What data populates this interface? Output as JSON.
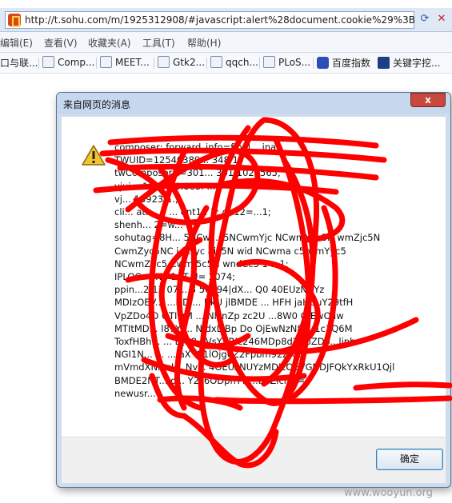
{
  "browser": {
    "url": "http://t.sohu.com/m/1925312908/#javascript:alert%28document.cookie%29%3B",
    "menu": [
      "编辑(E)",
      "查看(V)",
      "收藏夹(A)",
      "工具(T)",
      "帮助(H)"
    ],
    "favorites": [
      "口与联...",
      "Comp...",
      "MEET...",
      "Gtk2...",
      "qqch...",
      "PLoS...",
      "百度指数",
      "关键字挖..."
    ]
  },
  "dialog": {
    "title": "来自网页的消息",
    "close_label": "x",
    "ok_label": "确定",
    "message_lines": [
      "composer; forward_info=final...                  inal;",
      "TWUID=12540389...               348           1;",
      "twComposerH=301...                           301   1021565;",
      "vjui...          13     6    b.0.8e8.      ...;",
      "vj...    13923         ...;",
      "cli... at...   ...          ...       ent12   1; gn12=...1;",
      "shenh... 2=w...",
      "sohutag=8H...        5NCw...c5NCwmYjc    NCwmYSc5N  wmZjc5N",
      "CwmZyc5NC     j   5Nyc    aic5N    wid    NCwma c5      wmYyc5",
      "NCwmZSc5     Cwm    5c5N    wndCc5                  1     ...1;",
      "IPLOC=CN1     1; T     U=    2074;",
      "ppin...2|13    07     ...3   50394|dX...        Q0     40EUzNUYz",
      "MDIzOEV...   ...NDJ...  RkU   jlBMDE      ...  HFH     jaHUuY29tfH",
      "VpZDo4O     OTIwM      ...    NlcnZp      zc2U    ...8W0    OiEwOjIw",
      "MTItMD...    l87Y     ...  N    dxL    Bp   Do  OjEwNzN8  ...1c3Q6M",
      "ToxfHBh...           ...  DjB8...VsYXRlc246MDp8dXVpZDo...liph",
      "NGI1N...        ...           ...     aX      W1lOjg6Z2Fpbm92ZXJ8",
      "mVmdXNlcnI...     Nv...    4OEUzNUYzMDIzOEVGNDJFQkYxRkU1Qjl",
      "BMDE2NT...     o...  Y2s6ODpnYW...b3Zlcnw=;",
      "newusr..."
    ]
  },
  "watermark": "www.wooyun.org"
}
